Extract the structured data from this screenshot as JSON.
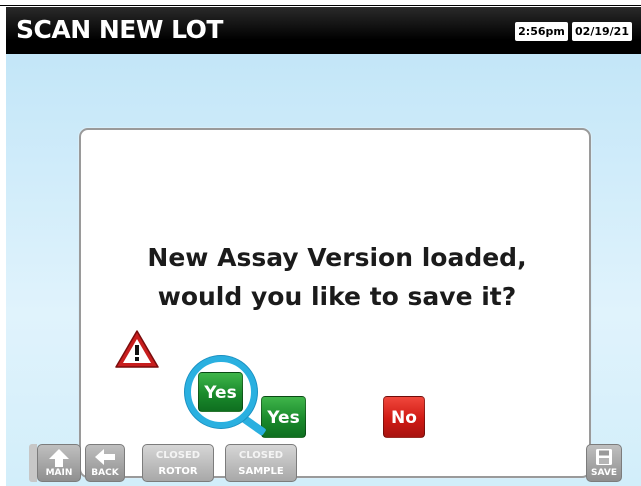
{
  "header": {
    "title": "SCAN NEW LOT",
    "time": "2:56pm",
    "date": "02/19/21"
  },
  "dialog": {
    "message": "New Assay Version loaded, would you like to save it?",
    "yes_label": "Yes",
    "no_label": "No",
    "callout_label": "Yes",
    "warning_icon": "warning-triangle-icon"
  },
  "footer": {
    "main_label": "MAIN",
    "back_label": "BACK",
    "rotor_top": "CLOSED",
    "rotor_bottom": "ROTOR",
    "sample_top": "CLOSED",
    "sample_bottom": "SAMPLE",
    "save_label": "SAVE"
  },
  "colors": {
    "accent": "#2ab0e0",
    "yes": "#1a8a2c",
    "no": "#d01a14",
    "background": "#c3e6f8"
  }
}
